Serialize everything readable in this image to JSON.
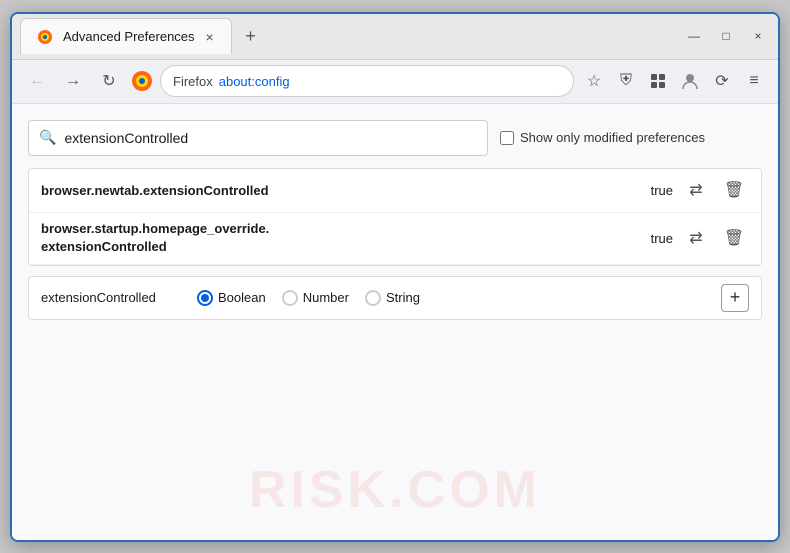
{
  "window": {
    "title": "Advanced Preferences",
    "tab_close": "×",
    "new_tab": "+",
    "minimize": "—",
    "maximize": "□",
    "close": "×"
  },
  "browser": {
    "firefox_label": "Firefox",
    "address": "about:config"
  },
  "search": {
    "placeholder": "extensionControlled",
    "value": "extensionControlled",
    "show_modified_label": "Show only modified preferences"
  },
  "preferences": [
    {
      "name": "browser.newtab.extensionControlled",
      "value": "true",
      "multiline": false
    },
    {
      "name_line1": "browser.startup.homepage_override.",
      "name_line2": "extensionControlled",
      "value": "true",
      "multiline": true
    }
  ],
  "add_row": {
    "name": "extensionControlled",
    "types": [
      "Boolean",
      "Number",
      "String"
    ],
    "selected_type": "Boolean",
    "add_label": "+"
  },
  "watermark": "RISK.COM",
  "icons": {
    "back": "←",
    "forward": "→",
    "reload": "↻",
    "bookmark": "☆",
    "shield": "⛨",
    "extensions": "🧩",
    "menu": "≡",
    "search": "🔍",
    "swap": "⇄",
    "delete": "🗑"
  }
}
